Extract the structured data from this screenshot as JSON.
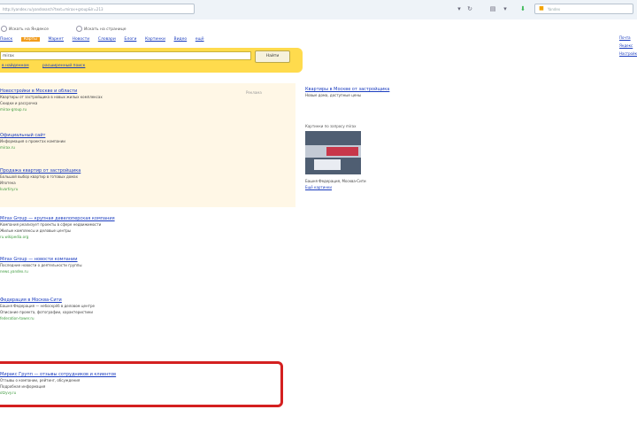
{
  "browser": {
    "address": "http://yandex.ru/yandsearch?text=mirax+group&lr=213",
    "search_placeholder": "Yandex"
  },
  "header": {
    "radio_1": "Искать на Яндексе",
    "radio_2": "Искать на странице",
    "services": [
      "Поиск",
      "Карты",
      "Маркет",
      "Новости",
      "Словари",
      "Блоги",
      "Картинки",
      "Видео",
      "ещё"
    ],
    "query": "mirax",
    "find_label": "Найти",
    "options": [
      "в найденном",
      "расширенный поиск"
    ],
    "ads_label": "Реклама",
    "right_links": [
      "Почта",
      "Яндекс",
      "Настройки"
    ]
  },
  "results": [
    {
      "title": "Новостройки в Москве и области",
      "snippet_1": "Квартиры от застройщика в новых жилых комплексах",
      "snippet_2": "Скидки и рассрочка",
      "url": "mirax-group.ru"
    },
    {
      "title": "Официальный сайт",
      "snippet_1": "Информация о проектах компании",
      "snippet_2": "",
      "url": "mirax.ru"
    },
    {
      "title": "Продажа квартир от застройщика",
      "snippet_1": "Большой выбор квартир в готовых домах",
      "snippet_2": "Ипотека",
      "url": "kvartiry.ru"
    },
    {
      "title": "Mirax Group — крупная девелоперская компания",
      "snippet_1": "Компания реализует проекты в сфере недвижимости",
      "snippet_2": "Жилые комплексы и деловые центры",
      "url": "ru.wikipedia.org"
    },
    {
      "title": "Mirax Group — новости компании",
      "snippet_1": "Последние новости о деятельности группы",
      "snippet_2": "",
      "url": "news.yandex.ru"
    },
    {
      "title": "Федерация в Москва-Сити",
      "snippet_1": "Башня Федерация — небоскрёб в деловом центре",
      "snippet_2": "Описание проекта, фотографии, характеристики",
      "url": "federation-tower.ru"
    },
    {
      "title": "Миракс Групп — отзывы сотрудников и клиентов",
      "snippet_1": "Отзывы о компании, рейтинг, обсуждения",
      "snippet_2": "Подробная информация",
      "url": "otzyvy.ru"
    }
  ],
  "right_ad": {
    "title": "Квартиры в Москве от застройщика",
    "snippet_1": "Новые дома, доступные цены",
    "img_label": "Картинки по запросу mirax",
    "img_caption": "Башня Федерация, Москва-Сити",
    "img_link": "Ещё картинки"
  }
}
